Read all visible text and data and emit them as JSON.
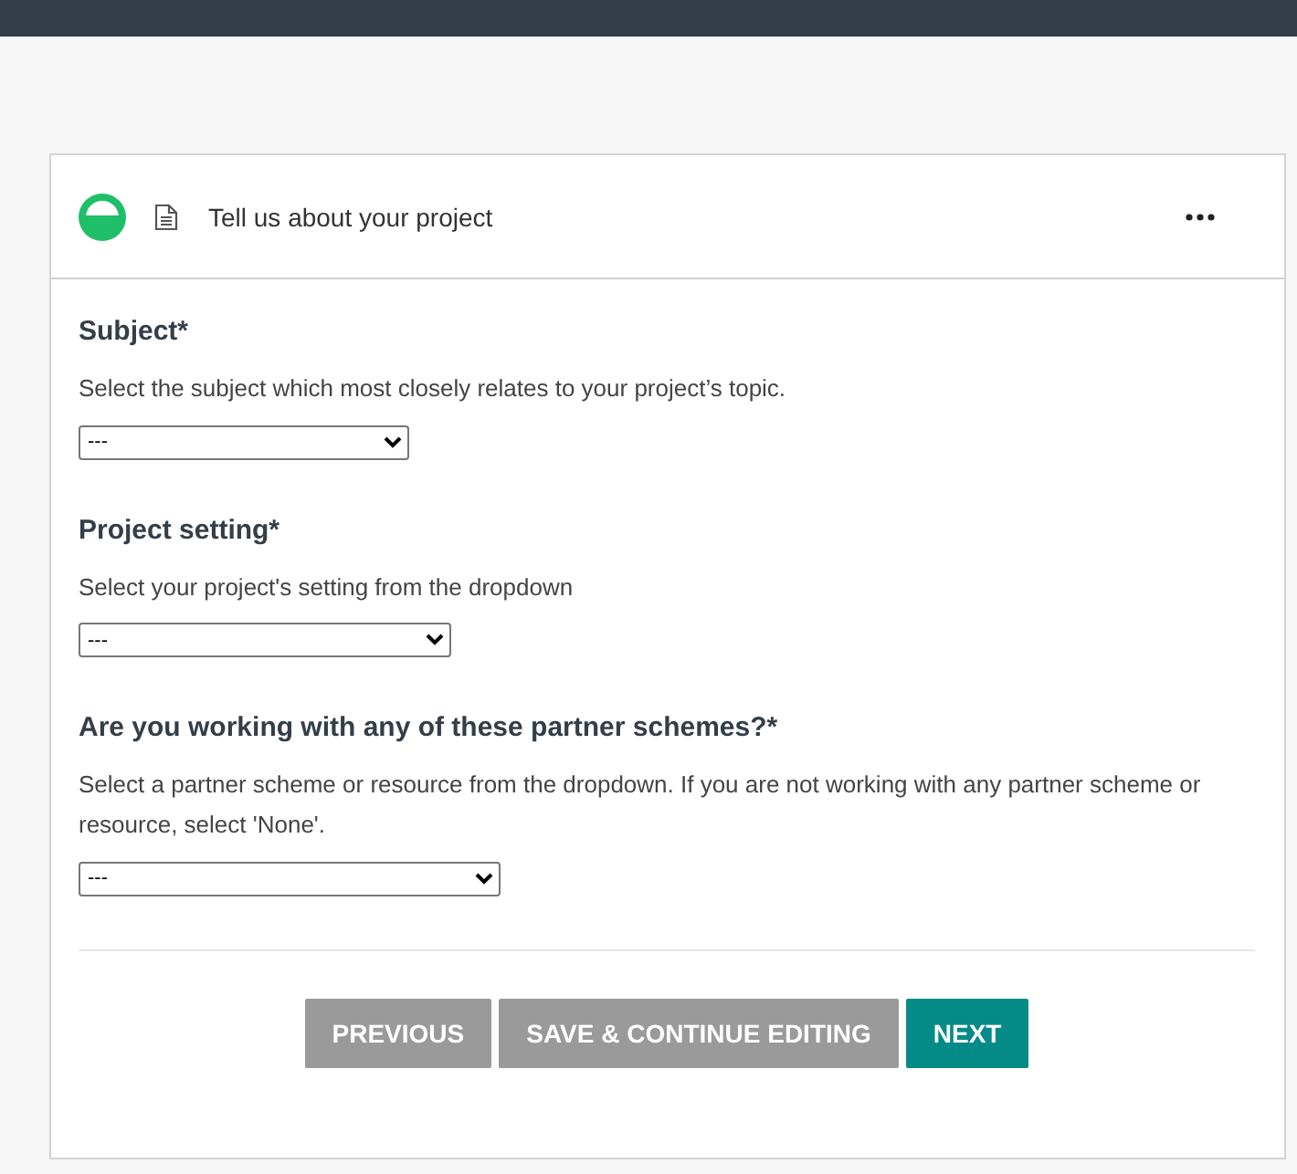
{
  "card": {
    "title": "Tell us about your project"
  },
  "fields": [
    {
      "label": "Subject*",
      "help": "Select the subject which most closely relates to your project’s topic.",
      "value": "---"
    },
    {
      "label": "Project setting*",
      "help": "Select your project's setting from the dropdown",
      "value": "---"
    },
    {
      "label": "Are you working with any of these partner schemes?*",
      "help": "Select a partner scheme or resource from the dropdown. If you are not working with any partner scheme or resource, select 'None'.",
      "value": "---"
    }
  ],
  "buttons": [
    {
      "label": "PREVIOUS",
      "kind": "secondary"
    },
    {
      "label": "SAVE & CONTINUE EDITING",
      "kind": "secondary"
    },
    {
      "label": "NEXT",
      "kind": "primary"
    }
  ]
}
